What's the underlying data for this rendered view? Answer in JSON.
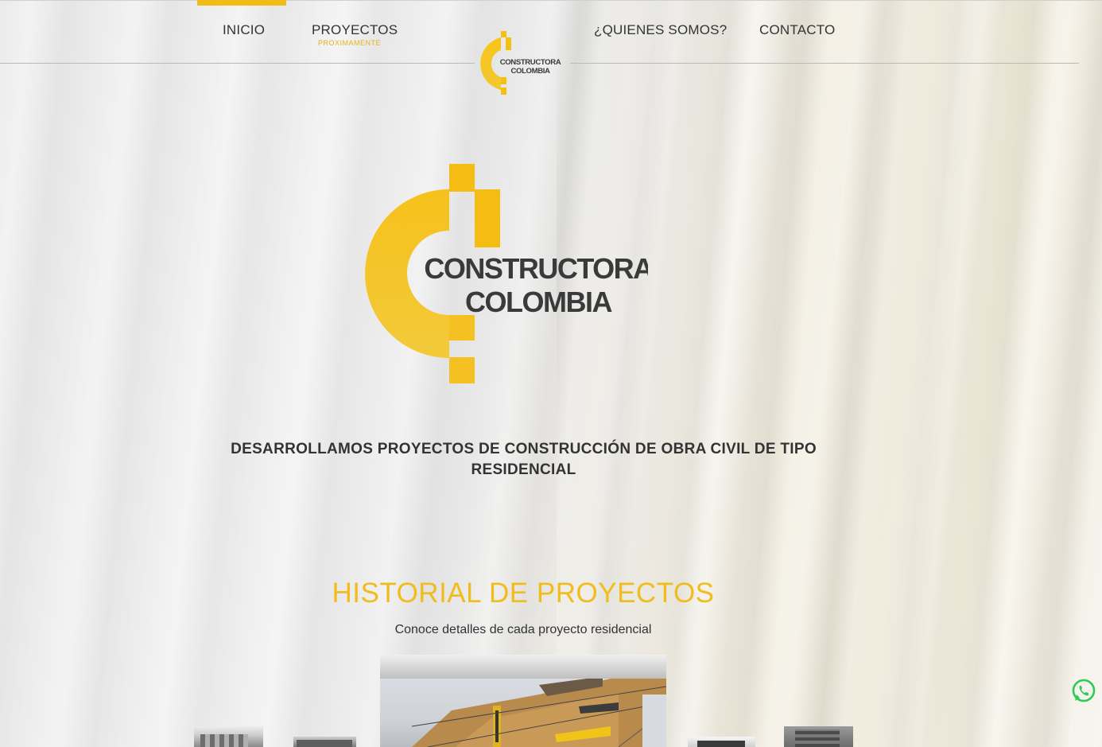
{
  "nav": {
    "items": [
      {
        "label": "INICIO",
        "active": true
      },
      {
        "label": "PROYECTOS",
        "sub": "PROXIMAMENTE"
      },
      {
        "label": "¿QUIENES SOMOS?"
      },
      {
        "label": "CONTACTO"
      }
    ]
  },
  "brand": {
    "line1": "CONSTRUCTORA",
    "line2": "COLOMBIA",
    "accent": "#f2bd17",
    "text_color": "#3a3a3a"
  },
  "hero": {
    "tagline_line1": "DESARROLLAMOS PROYECTOS DE CONSTRUCCIÓN DE OBRA CIVIL DE TIPO",
    "tagline_line2": "RESIDENCIAL"
  },
  "history": {
    "title": "HISTORIAL DE PROYECTOS",
    "subtitle": "Conoce detalles de cada proyecto residencial",
    "title_color": "#f1bc1d"
  },
  "floating": {
    "icon": "whatsapp-icon",
    "color": "#2ecc54"
  }
}
